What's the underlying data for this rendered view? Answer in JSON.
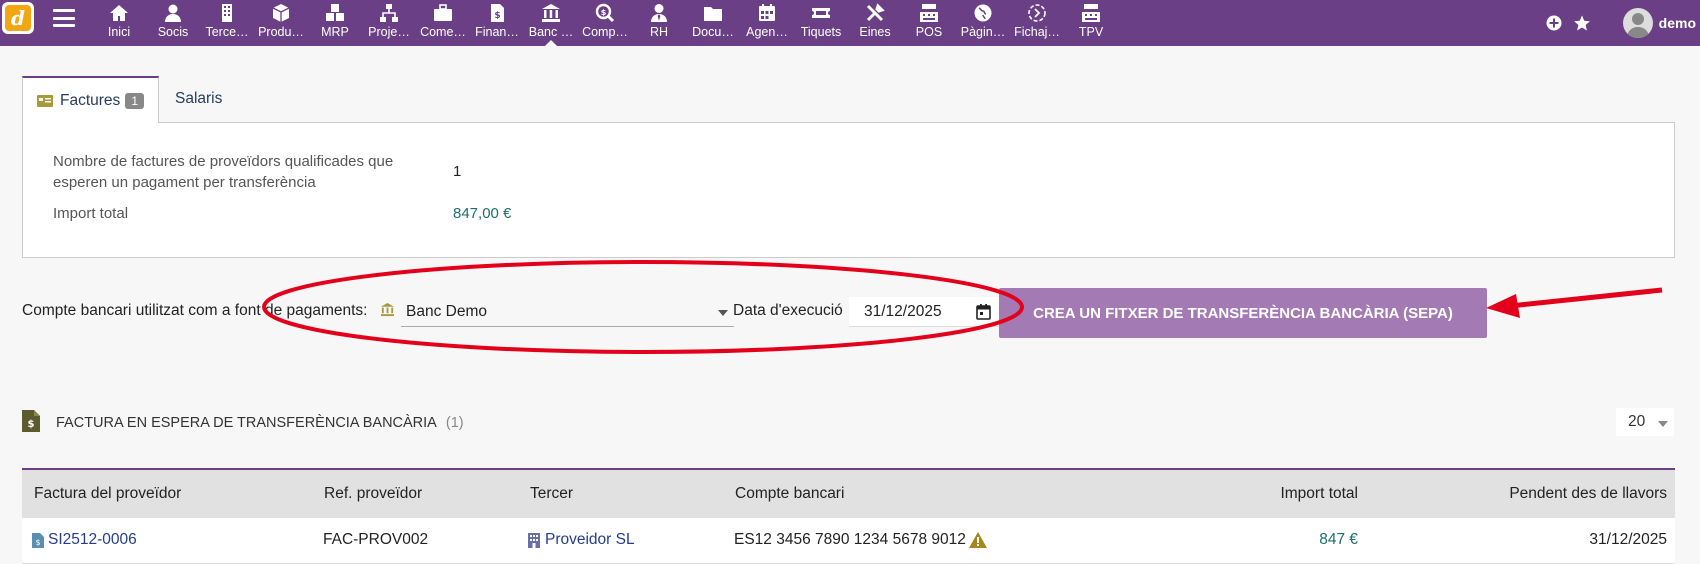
{
  "topbar": {
    "menu": [
      {
        "label": "Inici",
        "icon": "home-icon"
      },
      {
        "label": "Socis",
        "icon": "user-icon"
      },
      {
        "label": "Terce…",
        "icon": "building-icon"
      },
      {
        "label": "Produ…",
        "icon": "cube-icon"
      },
      {
        "label": "MRP",
        "icon": "cubes-icon"
      },
      {
        "label": "Proje…",
        "icon": "sitemap-icon"
      },
      {
        "label": "Come…",
        "icon": "briefcase-icon"
      },
      {
        "label": "Finan…",
        "icon": "invoice-icon"
      },
      {
        "label": "Banc …",
        "icon": "bank-icon"
      },
      {
        "label": "Comp…",
        "icon": "search-dollar-icon"
      },
      {
        "label": "RH",
        "icon": "user-tie-icon"
      },
      {
        "label": "Docu…",
        "icon": "folder-icon"
      },
      {
        "label": "Agen…",
        "icon": "calendar-icon"
      },
      {
        "label": "Tiquets",
        "icon": "ticket-icon"
      },
      {
        "label": "Eines",
        "icon": "tools-icon"
      },
      {
        "label": "POS",
        "icon": "cash-register-icon"
      },
      {
        "label": "Pàgin…",
        "icon": "globe-icon"
      },
      {
        "label": "Fichaj…",
        "icon": "clock-icon"
      },
      {
        "label": "TPV",
        "icon": "cash-register-icon"
      }
    ],
    "active_index": 8,
    "username": "demo"
  },
  "tabs": [
    {
      "label": "Factures",
      "badge": "1"
    },
    {
      "label": "Salaris"
    }
  ],
  "summary": {
    "count_label_line1": "Nombre de factures de proveïdors qualificades que",
    "count_label_line2": "esperen un pagament per transferència",
    "count_value": "1",
    "total_label": "Import total",
    "total_value": "847,00 €"
  },
  "payment": {
    "account_label": "Compte bancari utilitzat com a font de pagaments:",
    "account_value": "Banc Demo",
    "date_label": "Data d'execució",
    "date_value": "31/12/2025",
    "create_button": "CREA UN FITXER DE TRANSFERÈNCIA BANCÀRIA (SEPA)"
  },
  "list": {
    "title": "FACTURA EN ESPERA DE TRANSFERÈNCIA BANCÀRIA",
    "count": "(1)",
    "page_size": "20",
    "columns": [
      "Factura del proveïdor",
      "Ref. proveïdor",
      "Tercer",
      "Compte bancari",
      "Import total",
      "Pendent des de llavors"
    ],
    "rows": [
      {
        "invoice": "SI2512-0006",
        "ref": "FAC-PROV002",
        "thirdparty": "Proveidor SL",
        "bank_account": "ES12 3456 7890 1234 5678 9012",
        "amount": "847 €",
        "since": "31/12/2025"
      }
    ]
  },
  "colors": {
    "brand": "#6b3f85",
    "button": "#a37ab3",
    "annotation": "#e3001b",
    "amount": "#1c6d72"
  }
}
